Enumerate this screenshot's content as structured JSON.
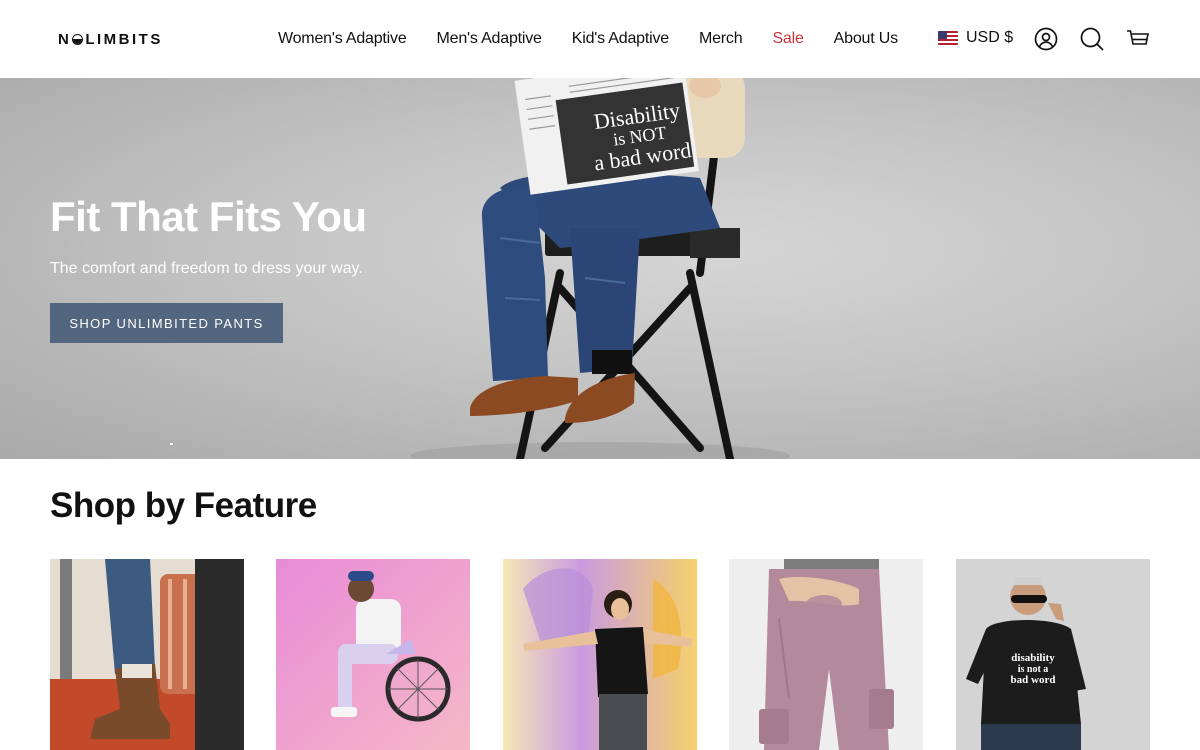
{
  "brand": {
    "logo_text_left": "N",
    "logo_text_right": "LIMBITS"
  },
  "nav": {
    "items": [
      {
        "label": "Women's Adaptive"
      },
      {
        "label": "Men's Adaptive"
      },
      {
        "label": "Kid's Adaptive"
      },
      {
        "label": "Merch"
      },
      {
        "label": "Sale"
      },
      {
        "label": "About Us"
      }
    ],
    "sale_color": "#c8353a"
  },
  "currency": {
    "label": "USD $",
    "flag": "us-flag-icon"
  },
  "icons": {
    "account": "account-icon",
    "search": "search-icon",
    "cart": "cart-icon"
  },
  "hero": {
    "title": "Fit That Fits You",
    "subtitle": "The comfort and freedom to dress your way.",
    "cta": "SHOP UNLIMBITED PANTS",
    "cta_color": "#53667f",
    "sign_line1": "Disability",
    "sign_line2": "is NOT",
    "sign_line3": "a bad word"
  },
  "features": {
    "title": "Shop by Feature",
    "tiles": [
      {
        "name": "feature-tile-boots"
      },
      {
        "name": "feature-tile-wheelchair"
      },
      {
        "name": "feature-tile-tee"
      },
      {
        "name": "feature-tile-pants"
      },
      {
        "name": "feature-tile-graphic-tee",
        "shirt_line1": "disability",
        "shirt_line2": "is not a",
        "shirt_line3": "bad word"
      }
    ]
  }
}
